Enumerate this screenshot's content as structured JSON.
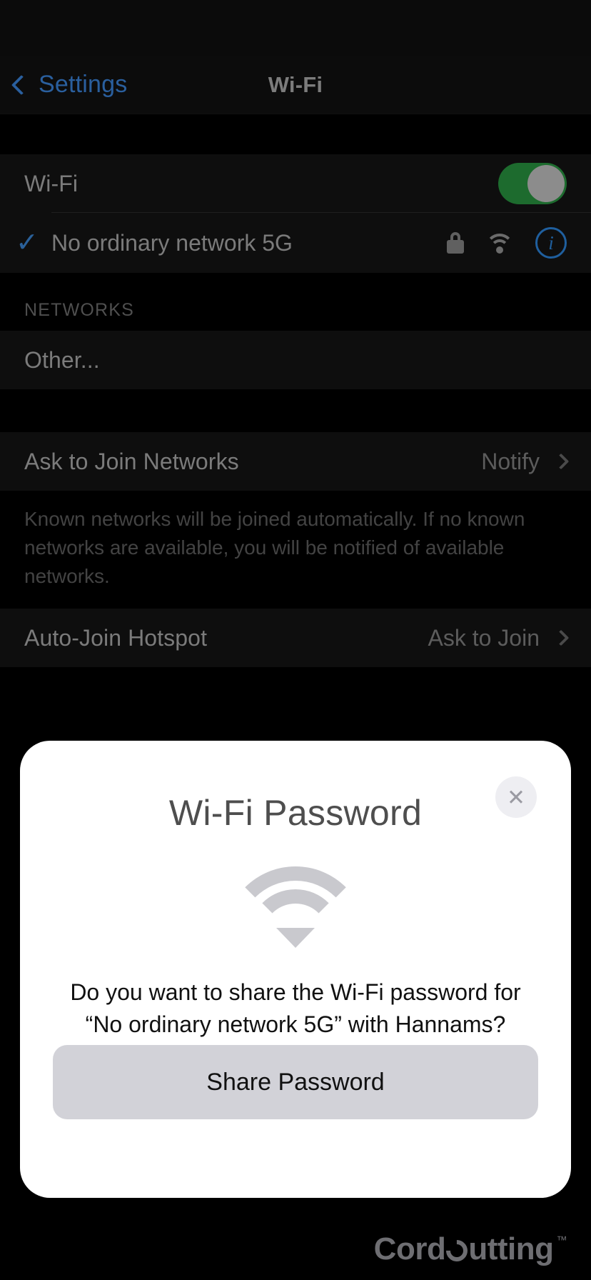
{
  "nav": {
    "back_label": "Settings",
    "title": "Wi-Fi",
    "back_icon": "chevron-left-icon",
    "accent_blue": "#2a5f9e"
  },
  "wifi_section": {
    "toggle_label": "Wi-Fi",
    "toggle_state": "on",
    "toggle_on_color": "#1d6b2e",
    "connected_network": {
      "name": "No ordinary network 5G",
      "checkmark": "✓",
      "lock_icon": "lock-icon",
      "signal_icon": "wifi-signal-icon",
      "info_icon": "info-circle-icon",
      "info_color": "#1f5f9e"
    }
  },
  "networks_section": {
    "header": "NETWORKS",
    "items": [
      {
        "label": "Other..."
      }
    ]
  },
  "ask_to_join": {
    "label": "Ask to Join Networks",
    "value": "Notify",
    "chevron": "chevron-right-icon",
    "footer": "Known networks will be joined automatically. If no known networks are available, you will be notified of available networks."
  },
  "auto_join_hotspot": {
    "label": "Auto-Join Hotspot",
    "value": "Ask to Join",
    "chevron": "chevron-right-icon"
  },
  "modal": {
    "title": "Wi-Fi Password",
    "close_label": "✕",
    "close_icon": "close-icon",
    "wifi_icon": "wifi-signal-icon",
    "body_line1": "Do you want to share the Wi-Fi password for",
    "body_line2": "“No ordinary network 5G” with Hannams?",
    "share_button": "Share Password",
    "button_color": "#d2d2d8"
  },
  "watermark": {
    "part1": "Cord",
    "part2": "utting",
    "trademark": "™"
  }
}
